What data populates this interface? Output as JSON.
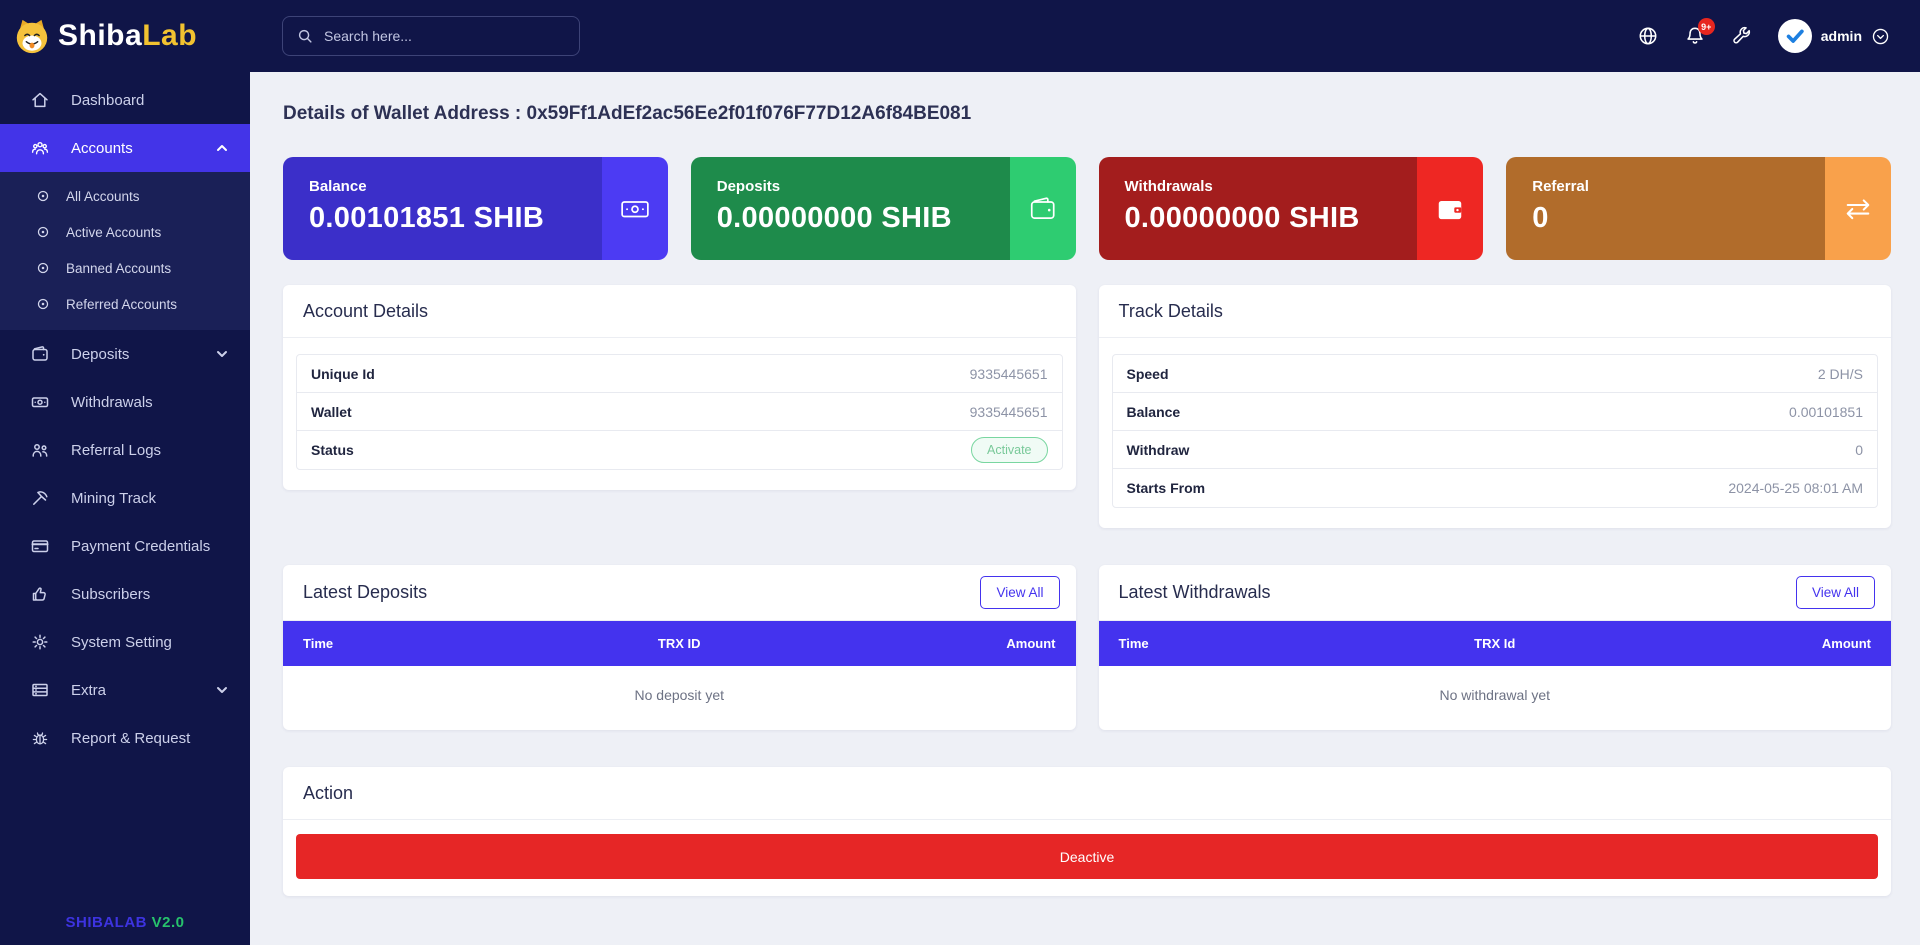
{
  "brand": {
    "name_primary": "Shiba",
    "name_secondary": "Lab",
    "footer_brand": "SHIBALAB",
    "footer_version": "V2.0"
  },
  "topbar": {
    "search_placeholder": "Search here...",
    "notification_badge": "9+",
    "user_name": "admin"
  },
  "sidebar": {
    "items": [
      {
        "label": "Dashboard"
      },
      {
        "label": "Accounts",
        "expanded": true
      },
      {
        "label": "Deposits"
      },
      {
        "label": "Withdrawals"
      },
      {
        "label": "Referral Logs"
      },
      {
        "label": "Mining Track"
      },
      {
        "label": "Payment Credentials"
      },
      {
        "label": "Subscribers"
      },
      {
        "label": "System Setting"
      },
      {
        "label": "Extra"
      },
      {
        "label": "Report & Request"
      }
    ],
    "accounts_sub": [
      {
        "label": "All Accounts"
      },
      {
        "label": "Active Accounts"
      },
      {
        "label": "Banned Accounts"
      },
      {
        "label": "Referred Accounts"
      }
    ]
  },
  "page": {
    "title": "Details of Wallet Address : 0x59Ff1AdEf2ac56Ee2f01f076F77D12A6f84BE081"
  },
  "stats": [
    {
      "label": "Balance",
      "value": "0.00101851 SHIB",
      "icon": "money-bill-icon",
      "color_main": "#3b2fc9",
      "color_accent": "#4c3bf3"
    },
    {
      "label": "Deposits",
      "value": "0.00000000 SHIB",
      "icon": "wallet-icon",
      "color_main": "#1e8b4b",
      "color_accent": "#2ecc71"
    },
    {
      "label": "Withdrawals",
      "value": "0.00000000 SHIB",
      "icon": "wallet-filled-icon",
      "color_main": "#a31d1d",
      "color_accent": "#ee2723"
    },
    {
      "label": "Referral",
      "value": "0",
      "icon": "exchange-icon",
      "color_main": "#b16c2b",
      "color_accent": "#f9a14b"
    }
  ],
  "account_details": {
    "title": "Account Details",
    "rows": [
      {
        "label": "Unique Id",
        "value": "9335445651"
      },
      {
        "label": "Wallet",
        "value": "9335445651"
      }
    ],
    "status_label": "Status",
    "status_value": "Activate"
  },
  "track_details": {
    "title": "Track Details",
    "rows": [
      {
        "label": "Speed",
        "value": "2 DH/S"
      },
      {
        "label": "Balance",
        "value": "0.00101851"
      },
      {
        "label": "Withdraw",
        "value": "0"
      },
      {
        "label": "Starts From",
        "value": "2024-05-25 08:01 AM"
      }
    ]
  },
  "latest_deposits": {
    "title": "Latest Deposits",
    "view_all": "View All",
    "columns": [
      "Time",
      "TRX ID",
      "Amount"
    ],
    "empty": "No deposit yet"
  },
  "latest_withdrawals": {
    "title": "Latest Withdrawals",
    "view_all": "View All",
    "columns": [
      "Time",
      "TRX Id",
      "Amount"
    ],
    "empty": "No withdrawal yet"
  },
  "action": {
    "title": "Action",
    "button": "Deactive"
  }
}
